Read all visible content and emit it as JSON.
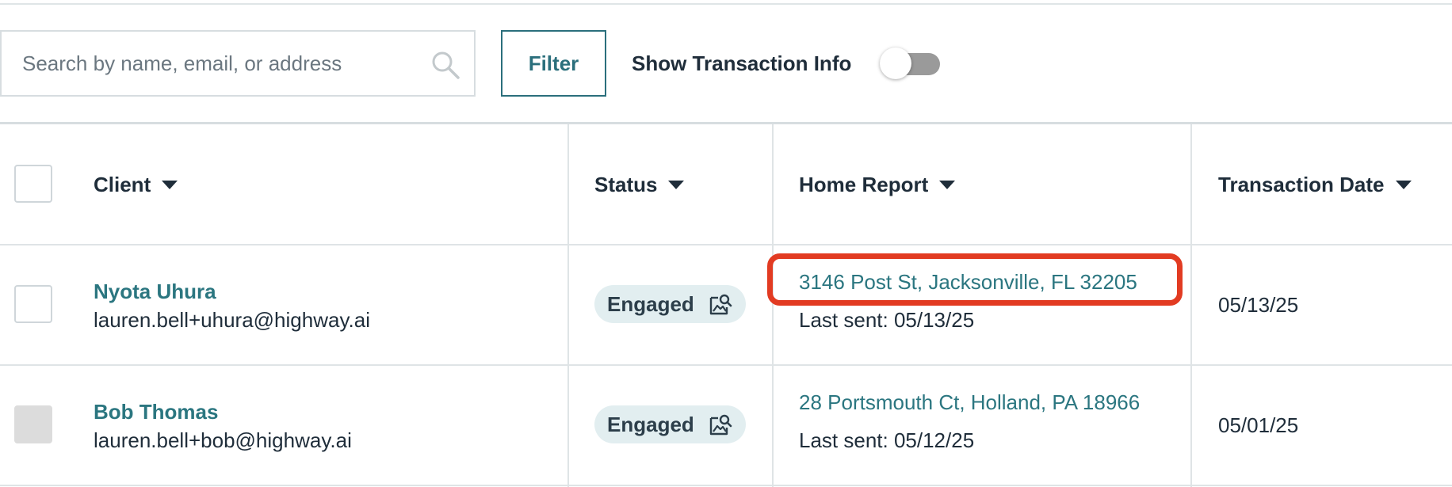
{
  "toolbar": {
    "search": {
      "placeholder": "Search by name, email, or address",
      "value": ""
    },
    "filter_label": "Filter",
    "toggle_label": "Show Transaction Info",
    "toggle_on": false
  },
  "table": {
    "columns": [
      {
        "label": "Client"
      },
      {
        "label": "Status"
      },
      {
        "label": "Home Report"
      },
      {
        "label": "Transaction Date"
      }
    ],
    "rows": [
      {
        "name": "Nyota Uhura",
        "email": "lauren.bell+uhura@highway.ai",
        "status": "Engaged",
        "address": "3146 Post St, Jacksonville, FL 32205",
        "last_sent": "Last sent: 05/13/25",
        "date": "05/13/25",
        "highlighted": true
      },
      {
        "name": "Bob Thomas",
        "email": "lauren.bell+bob@highway.ai",
        "status": "Engaged",
        "address": "28 Portsmouth Ct, Holland, PA 18966",
        "last_sent": "Last sent: 05/12/25",
        "date": "05/01/25",
        "highlighted": false
      }
    ]
  },
  "colors": {
    "accent": "#2b7680",
    "badge_bg": "#e2eef0",
    "highlight": "#e23b22",
    "toggle_off": "#9a9a9a"
  },
  "icons": {
    "search": "search-icon",
    "sort": "caret-down-icon",
    "status": "image-search-icon"
  }
}
